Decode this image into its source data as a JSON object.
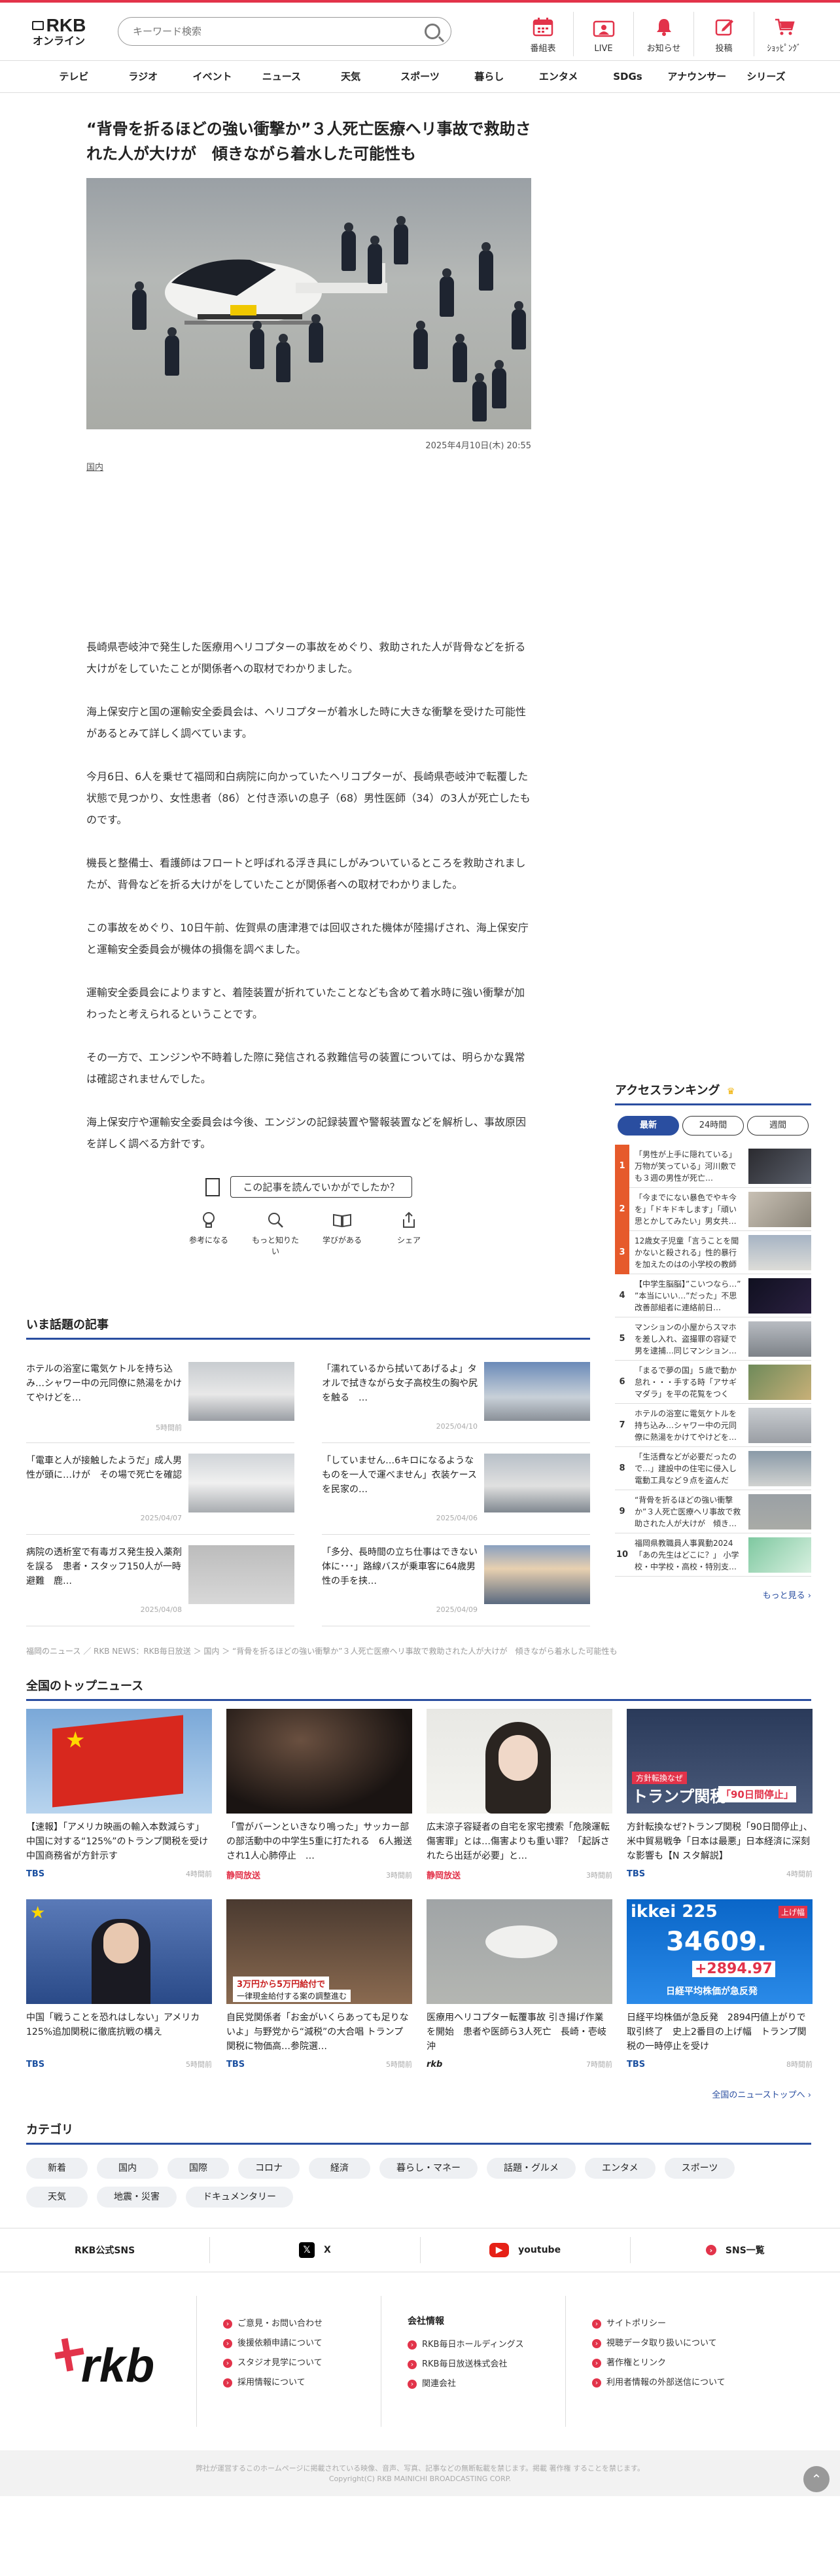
{
  "header": {
    "logo_top": "RKB",
    "logo_bottom": "オンライン",
    "search_placeholder": "キーワード検索",
    "icons": [
      {
        "label": "番組表",
        "icon": "calendar-icon"
      },
      {
        "label": "LIVE",
        "icon": "live-icon"
      },
      {
        "label": "お知らせ",
        "icon": "bell-icon"
      },
      {
        "label": "投稿",
        "icon": "post-icon"
      },
      {
        "label": "ｼｮｯﾋﾟﾝｸﾞ",
        "icon": "cart-icon"
      }
    ],
    "accent_color": "#e2334a"
  },
  "nav": [
    "テレビ",
    "ラジオ",
    "イベント",
    "ニュース",
    "天気",
    "スポーツ",
    "暮らし",
    "エンタメ",
    "SDGs",
    "アナウンサー",
    "シリーズ"
  ],
  "article": {
    "title": "“背骨を折るほどの強い衝撃か”３人死亡医療ヘリ事故で救助された人が大けが　傾きながら着水した可能性も",
    "date": "2025年4月10日(木) 20:55",
    "category": "国内",
    "paragraphs": [
      "長崎県壱岐沖で発生した医療用ヘリコプターの事故をめぐり、救助された人が背骨などを折る大けがをしていたことが関係者への取材でわかりました。",
      "海上保安庁と国の運輸安全委員会は、ヘリコプターが着水した時に大きな衝撃を受けた可能性があるとみて詳しく調べています。",
      "今月6日、6人を乗せて福岡和白病院に向かっていたヘリコプターが、長崎県壱岐沖で転覆した状態で見つかり、女性患者（86）と付き添いの息子（68）男性医師（34）の3人が死亡したものです。",
      "機長と整備士、看護師はフロートと呼ばれる浮き具にしがみついているところを救助されましたが、背骨などを折る大けがをしていたことが関係者への取材でわかりました。",
      "この事故をめぐり、10日午前、佐賀県の唐津港では回収された機体が陸揚げされ、海上保安庁と運輸安全委員会が機体の損傷を調べました。",
      "運輸安全委員会によりますと、着陸装置が折れていたことなども含めて着水時に強い衝撃が加わったと考えられるということです。",
      "その一方で、エンジンや不時着した際に発信される救難信号の装置については、明らかな異常は確認されませんでした。",
      "海上保安庁や運輸安全委員会は今後、エンジンの記録装置や警報装置などを解析し、事故原因を詳しく調べる方針です。"
    ],
    "feedback_question": "この記事を読んでいかがでしたか？",
    "feedback_options": [
      {
        "label": "参考になる",
        "icon": "lightbulb-icon"
      },
      {
        "label": "もっと知りたい",
        "icon": "magnifier-icon"
      },
      {
        "label": "学びがある",
        "icon": "book-icon"
      },
      {
        "label": "シェア",
        "icon": "share-icon"
      }
    ]
  },
  "ranking": {
    "title": "アクセスランキング",
    "tabs": [
      "最新",
      "24時間",
      "週間"
    ],
    "items": [
      {
        "num": "1",
        "text": "「男性が上手に隠れている」万物が笑っている」河川敷でも３週の男性が死亡…"
      },
      {
        "num": "2",
        "text": "「今までにない暴色でやキ今を」「ドキドキします」「頑い思とかしてみたい」男女共…"
      },
      {
        "num": "3",
        "text": "12歳女子児童「言うことを聞かないと殺される」性的暴行を加えたのはの小学校の教師と…"
      },
      {
        "num": "4",
        "text": "【中学生脳脳】”こいつなら…” ”本当にいい…”だった」不思改善部組者に連絡前日…"
      },
      {
        "num": "5",
        "text": "マンションの小屋からスマホを差し入れ、盗撮罪の容疑で男を逮捕…同じマンション…"
      },
      {
        "num": "6",
        "text": "「まるで夢の国」５歳で動か怠れ・・・手する時「アサギマダラ」を平の花覧をつくっ…"
      },
      {
        "num": "7",
        "text": "ホテルの浴室に電気ケトルを持ち込み…シャワー中の元同僚に熱湯をかけてやけどを…"
      },
      {
        "num": "8",
        "text": "「生活費などが必要だったので…」建設中の住宅に侵入し電動工具など９点を盗んだ疑…"
      },
      {
        "num": "9",
        "text": "“背骨を折るほどの強い衝撃か”３人死亡医療ヘリ事故で救助された人が大けが　傾き…"
      },
      {
        "num": "10",
        "text": "福岡県教職員人事異動2024「あの先生はどこに？」 小学校・中学校・高校・特別支…"
      }
    ],
    "more": "もっと見る ›"
  },
  "popular": {
    "title": "いま話題の記事",
    "items": [
      {
        "title": "ホテルの浴室に電気ケトルを持ち込み…シャワー中の元同僚に熱湯をかけてやけどを…",
        "date": "5時間前"
      },
      {
        "title": "「濡れているから拭いてあげるよ」タオルで拭きながら女子高校生の胸や尻を触る　…",
        "date": "2025/04/10"
      },
      {
        "title": "「電車と人が接触したようだ」成人男性が頭に…けが　その場で死亡を確認",
        "date": "2025/04/07"
      },
      {
        "title": "「していません…6キロになるようなものを一人で運べません」衣装ケースを民家の…",
        "date": "2025/04/06"
      },
      {
        "title": "病院の透析室で有毒ガス発生投入薬剤を誤る　患者・スタッフ150人が一時避難　鹿…",
        "date": "2025/04/08"
      },
      {
        "title": "「多分、長時間の立ち仕事はできない体に･･･」路線バスが乗車客に64歳男性の手を挟…",
        "date": "2025/04/09"
      }
    ]
  },
  "breadcrumb": "福岡のニュース ／ RKB NEWS：RKB毎日放送 ＞ 国内 ＞ “背骨を折るほどの強い衝撃か”３人死亡医療ヘリ事故で救助された人が大けが　傾きながら着水した可能性も",
  "national": {
    "title": "全国のトップニュース",
    "items": [
      {
        "title": "【速報】「アメリカ映画の輸入本数減らす」中国に対する“125%”のトランプ関税を受け　中国商務省が方針示す",
        "src": "TBS",
        "date": "4時間前"
      },
      {
        "title": "「雪がバーンといきなり鳴った」サッカー部の部活動中の中学生5重に打たれる　6人搬送され1人心肺停止　…",
        "src": "静岡放送",
        "date": "3時間前"
      },
      {
        "title": "広末涼子容疑者の自宅を家宅捜索「危険運転傷害罪」とは…傷害よりも重い罪？「起訴されたら出廷が必要」と…",
        "src": "静岡放送",
        "date": "3時間前"
      },
      {
        "title": "方針転換なぜ?トランプ関税「90日間停止」、米中貿易戦争「日本は最悪」日本経済に深刻な影響も【N スタ解説】",
        "src": "TBS",
        "date": "4時間前"
      },
      {
        "title": "中国「戦うことを恐れはしない」アメリカ125%追加関税に徹底抗戦の構え",
        "src": "TBS",
        "date": "5時間前"
      },
      {
        "title": "自民党関係者「お金がいくらあっても足りないよ」与野党から“減税”の大合唱 トランプ関税に物価高…参院選…",
        "src": "TBS",
        "date": "5時間前"
      },
      {
        "title": "医療用ヘリコプター転覆事故 引き揚げ作業を開始　患者や医師ら3人死亡　長崎・壱岐沖",
        "src": "rkb",
        "date": "7時間前"
      },
      {
        "title": "日経平均株価が急反発　2894円値上がりで取引終了　史上2番目の上げ幅　トランプ関税の一時停止を受け",
        "src": "TBS",
        "date": "8時間前"
      }
    ],
    "img_text": {
      "tariff_banner": "方針転換なぜ",
      "tariff_big": "トランプ関税",
      "tariff_badge": "「90日間停止」",
      "money_line1": "3万円から5万円給付で",
      "money_line2": "一律現金給付する案の調整進む",
      "nikkei_label": "ikkei 225",
      "nikkei_value": "34609.",
      "nikkei_change": "+2894.97",
      "nikkei_pct": "日経平均株価が急反発",
      "nikkei_top": "上げ幅"
    },
    "more": "全国のニューストップへ ›"
  },
  "categories": {
    "title": "カテゴリ",
    "items": [
      "新着",
      "国内",
      "国際",
      "コロナ",
      "経済",
      "暮らし・マネー",
      "話題・グルメ",
      "エンタメ",
      "スポーツ",
      "天気",
      "地震・災害",
      "ドキュメンタリー"
    ]
  },
  "sns": {
    "label": "RKB公式SNS",
    "items": [
      {
        "label": "X",
        "icon": "x-icon"
      },
      {
        "label": "youtube",
        "icon": "youtube-icon"
      },
      {
        "label": "SNS一覧",
        "icon": "sns-list-icon"
      }
    ]
  },
  "footer": {
    "logo": "rkb",
    "col1": [
      "ご意見・お問い合わせ",
      "後援依頼申請について",
      "スタジオ見学について",
      "採用情報について"
    ],
    "col2_head": "会社情報",
    "col2": [
      "RKB毎日ホールディングス",
      "RKB毎日放送株式会社",
      "関連会社"
    ],
    "col3": [
      "サイトポリシー",
      "視聴データ取り扱いについて",
      "著作権とリンク",
      "利用者情報の外部送信について"
    ],
    "copy_line1": "弊社が運営するこのホームページに掲載されている映像、音声、写真、記事などの無断転載を禁じます。掲載 著作権 することを禁じます。",
    "copy_line2": "Copyright(C) RKB MAINICHI BROADCASTING CORP."
  }
}
